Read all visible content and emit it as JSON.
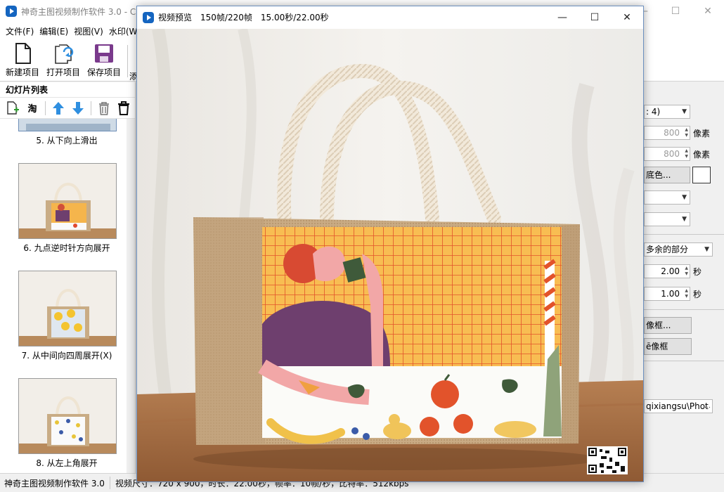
{
  "main_window": {
    "title": "神奇主图视频制作软件 3.0 - C:"
  },
  "menu": [
    {
      "label": "文件(F)"
    },
    {
      "label": "编辑(E)"
    },
    {
      "label": "视图(V)"
    },
    {
      "label": "水印(W"
    }
  ],
  "toolbar": {
    "new_project": "新建项目",
    "open_project": "打开项目",
    "save_project": "保存项目",
    "clipped_button": "添"
  },
  "slide_panel": {
    "title": "幻灯片列表",
    "taobao_label": "淘",
    "slides": [
      {
        "label": "5. 从下向上滑出",
        "pattern": "partial"
      },
      {
        "label": "6. 九点逆时针方向展开",
        "pattern": "illustration"
      },
      {
        "label": "7. 从中间向四周展开(X)",
        "pattern": "lemon"
      },
      {
        "label": "8. 从左上角展开",
        "pattern": "dots"
      }
    ]
  },
  "properties": {
    "ratio": ": 4)",
    "width": "800",
    "width_unit": "像素",
    "height": "800",
    "height_unit": "像素",
    "bg_color_button": "底色...",
    "bg_color": "#ffffff",
    "combo_a": "",
    "combo_b": "",
    "extra_option": "多余的部分",
    "duration_1": "2.00",
    "duration_1_unit": "秒",
    "duration_2": "1.00",
    "duration_2_unit": "秒",
    "frame_button": "像框...",
    "remove_frame_button": "ē像框",
    "output_path": "qixiangsu\\Phot"
  },
  "status": {
    "app_name": "神奇主图视频制作软件 3.0",
    "info": "视频尺寸：720 x 900，时长：22.00秒，帧率：10帧/秒，比特率：512kbps"
  },
  "preview": {
    "title": "视频预览",
    "frames": "150帧/220帧",
    "time": "15.00秒/22.00秒"
  },
  "colors": {
    "accent": "#1565c0",
    "arrow_blue": "#2f8fe0",
    "save_purple": "#7a3a8c",
    "burlap": "#c9ac85",
    "grid_orange": "#f5b54c"
  }
}
